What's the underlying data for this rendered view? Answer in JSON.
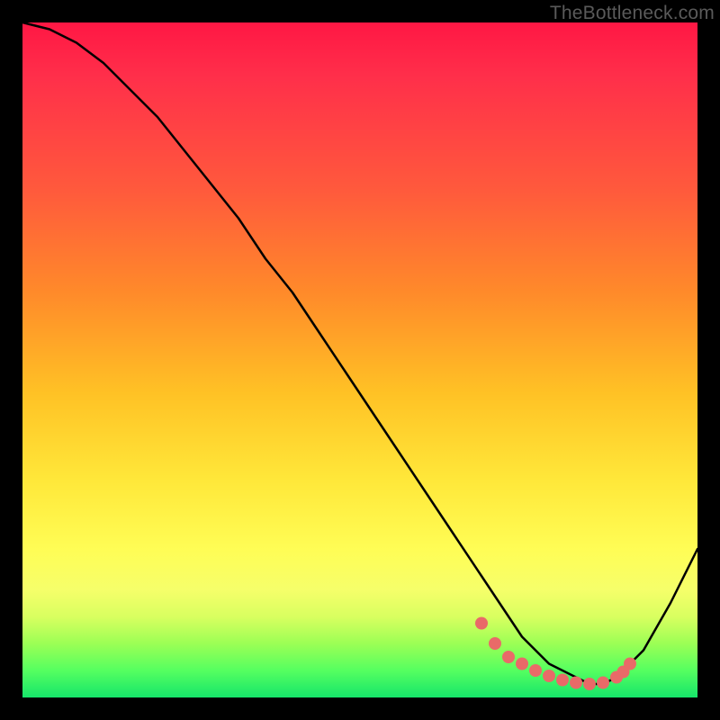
{
  "watermark": "TheBottleneck.com",
  "chart_data": {
    "type": "line",
    "title": "",
    "xlabel": "",
    "ylabel": "",
    "xlim": [
      0,
      100
    ],
    "ylim": [
      0,
      100
    ],
    "grid": false,
    "legend": false,
    "series": [
      {
        "name": "curve",
        "color": "#000000",
        "x": [
          0,
          4,
          8,
          12,
          16,
          20,
          24,
          28,
          32,
          36,
          40,
          44,
          48,
          52,
          56,
          60,
          64,
          68,
          72,
          74,
          76,
          78,
          80,
          82,
          84,
          86,
          88,
          92,
          96,
          100
        ],
        "values": [
          100,
          99,
          97,
          94,
          90,
          86,
          81,
          76,
          71,
          65,
          60,
          54,
          48,
          42,
          36,
          30,
          24,
          18,
          12,
          9,
          7,
          5,
          4,
          3,
          2,
          2,
          3,
          7,
          14,
          22
        ]
      }
    ],
    "markers": {
      "name": "highlight-dots",
      "color": "#e96a68",
      "radius": 7,
      "x": [
        68,
        70,
        72,
        74,
        76,
        78,
        80,
        82,
        84,
        86,
        88,
        89,
        90
      ],
      "values": [
        11,
        8,
        6,
        5,
        4,
        3.2,
        2.6,
        2.2,
        2.0,
        2.2,
        3.0,
        3.8,
        5.0
      ]
    }
  }
}
